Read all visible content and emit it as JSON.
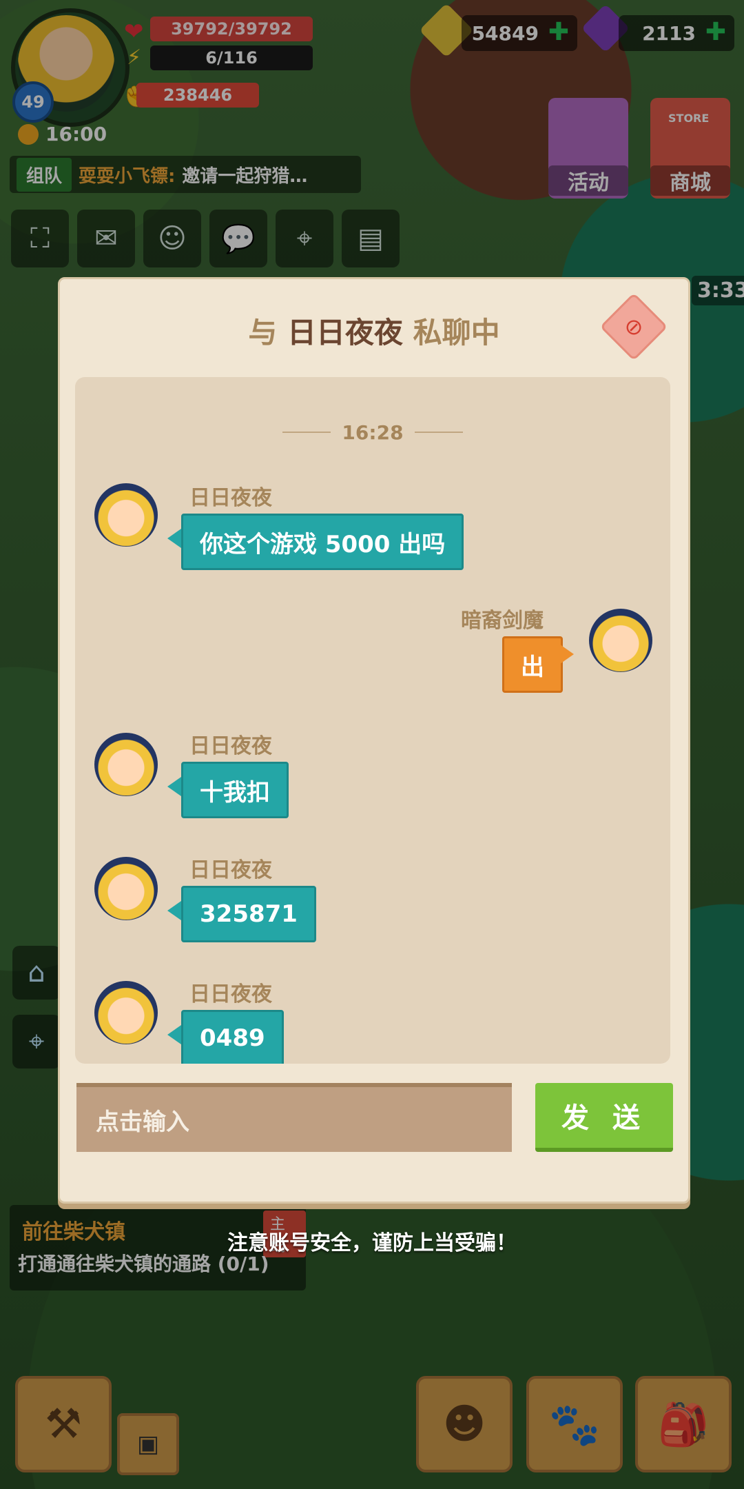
{
  "hud": {
    "level": "49",
    "hp": "39792/39792",
    "energy": "6/116",
    "power": "238446",
    "gold": "54849",
    "gems": "2113",
    "time": "16:00"
  },
  "team": {
    "tag": "组队",
    "name": "耍耍小飞镖:",
    "message": "邀请一起狩猎…"
  },
  "activities": [
    {
      "label": "活动"
    },
    {
      "label": "商城",
      "tag": "STORE"
    }
  ],
  "event_timer": "3:33",
  "dialog": {
    "title_prefix": "与",
    "partner": "日日夜夜",
    "title_suffix": "私聊中",
    "timestamp": "16:28",
    "messages": [
      {
        "sender": "日日夜夜",
        "text": "你这个游戏 5000 出吗",
        "side": "left"
      },
      {
        "sender": "暗裔剑魔",
        "text": "出",
        "side": "right"
      },
      {
        "sender": "日日夜夜",
        "text": "十我扣",
        "side": "left"
      },
      {
        "sender": "日日夜夜",
        "text": "325871",
        "side": "left"
      },
      {
        "sender": "日日夜夜",
        "text": "0489",
        "side": "left"
      }
    ],
    "input_placeholder": "点击输入",
    "send_label": "发 送"
  },
  "quest": {
    "title": "前往柴犬镇",
    "tag": "主线",
    "desc": "打通通往柴犬镇的通路 (0/1)"
  },
  "warning": "注意账号安全，谨防上当受骗！",
  "colors": {
    "bubble_other": "#24a6a6",
    "bubble_self": "#ef8f2b",
    "send_button": "#7dc43a"
  }
}
